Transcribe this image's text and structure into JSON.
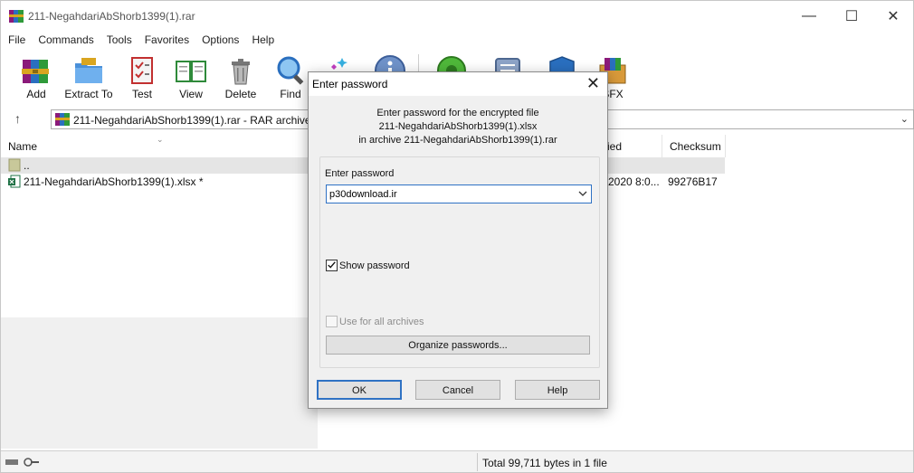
{
  "window": {
    "title": "211-NegahdariAbShorb1399(1).rar",
    "minimize_glyph": "—",
    "maximize_glyph": "☐",
    "close_glyph": "✕"
  },
  "menu": [
    "File",
    "Commands",
    "Tools",
    "Favorites",
    "Options",
    "Help"
  ],
  "toolbar": [
    {
      "label": "Add",
      "icon": "archive-books-icon"
    },
    {
      "label": "Extract To",
      "icon": "folder-extract-icon"
    },
    {
      "label": "Test",
      "icon": "checklist-icon"
    },
    {
      "label": "View",
      "icon": "open-book-icon"
    },
    {
      "label": "Delete",
      "icon": "trash-can-icon"
    },
    {
      "label": "Find",
      "icon": "magnifier-icon"
    },
    {
      "label": "",
      "icon": "wizard-icon"
    },
    {
      "label": "",
      "icon": "info-icon"
    },
    {
      "label": "",
      "icon": "virus-scan-icon"
    },
    {
      "label": "",
      "icon": "comment-icon"
    },
    {
      "label": "",
      "icon": "protect-icon"
    },
    {
      "label": "SFX",
      "icon": "sfx-icon"
    }
  ],
  "address": {
    "up_glyph": "↑",
    "path": "211-NegahdariAbShorb1399(1).rar - RAR archive,",
    "dropdown_glyph": "⌄"
  },
  "columns": {
    "name": "Name",
    "modified": "ied",
    "checksum": "Checksum"
  },
  "rows": [
    {
      "name": "..",
      "modified": "",
      "checksum": ""
    },
    {
      "name": "211-NegahdariAbShorb1399(1).xlsx *",
      "modified": "2020 8:0...",
      "checksum": "99276B17"
    }
  ],
  "status": {
    "text": "Total 99,711 bytes in 1 file"
  },
  "dialog": {
    "title": "Enter password",
    "close_glyph": "✕",
    "info_line1": "Enter password for the encrypted file",
    "info_line2": "211-NegahdariAbShorb1399(1).xlsx",
    "info_line3": "in archive 211-NegahdariAbShorb1399(1).rar",
    "field_label": "Enter password",
    "password_value": "p30download.ir",
    "show_password_label": "Show password",
    "show_password_checked": true,
    "use_all_label": "Use for all archives",
    "use_all_checked": false,
    "organize_label": "Organize passwords...",
    "ok_label": "OK",
    "cancel_label": "Cancel",
    "help_label": "Help"
  },
  "colors": {
    "accent": "#2f72c4",
    "selected_row": "#e5e5e5"
  }
}
